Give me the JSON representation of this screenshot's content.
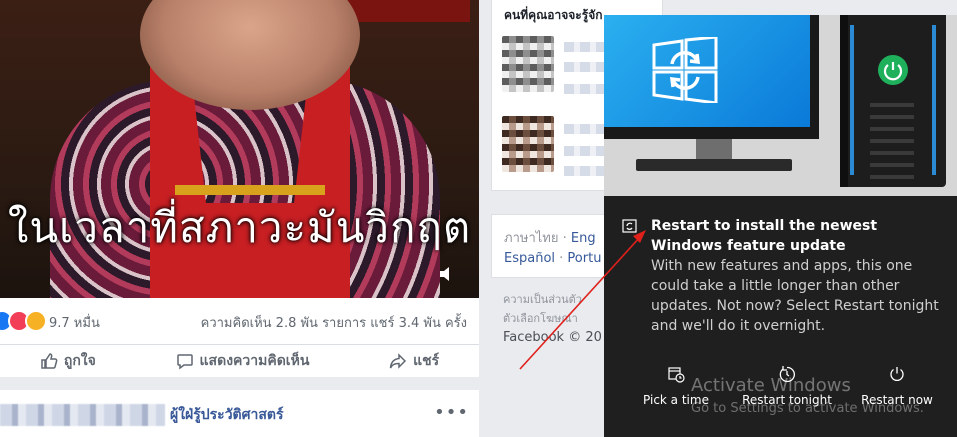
{
  "post": {
    "subtitle": "ในเวลาที่สภาวะมันวิกฤต",
    "reaction_count": "9.7 หมื่น",
    "comment_stats": "ความคิดเห็น 2.8 พัน รายการ  แชร์ 3.4 พัน ครั้ง",
    "actions": {
      "like": "ถูกใจ",
      "comment": "แสดงความคิดเห็น",
      "share": "แชร์"
    }
  },
  "post2": {
    "title": "ผู้ใฝ่รู้ประวัติศาสตร์",
    "more": "•••"
  },
  "right_column": {
    "suggestions_title": "คนที่คุณอาจจะรู้จัก",
    "languages_line1_prefix": "ภาษาไทย · ",
    "languages_line1_link": "Eng",
    "languages_line2_a": "Español",
    "languages_line2_sep": " · ",
    "languages_line2_b": "Portu",
    "legal_1": "ความเป็นส่วนตัว",
    "legal_2": "ตัวเลือกโฆษณา",
    "copyright": "Facebook © 20"
  },
  "toast": {
    "title": "Restart to install the newest Windows feature update",
    "body": "With new features and apps, this one could take a little longer than other updates. Not now? Select Restart tonight and we'll do it overnight.",
    "buttons": {
      "pick_time": "Pick a time",
      "restart_tonight": "Restart tonight",
      "restart_now": "Restart now"
    },
    "watermark_title": "Activate Windows",
    "watermark_sub": "Go to Settings to activate Windows."
  },
  "colors": {
    "facebook_blue": "#385898",
    "toast_bg": "#1f1f1f",
    "windows_blue": "#0a7ad8",
    "annotation_red": "#e0201b",
    "power_green": "#1fb05c"
  },
  "icons": [
    "speaker-icon",
    "like-icon",
    "comment-icon",
    "share-icon",
    "bell-sync-icon",
    "calendar-clock-icon",
    "restart-icon",
    "power-icon",
    "windows-update-icon"
  ]
}
